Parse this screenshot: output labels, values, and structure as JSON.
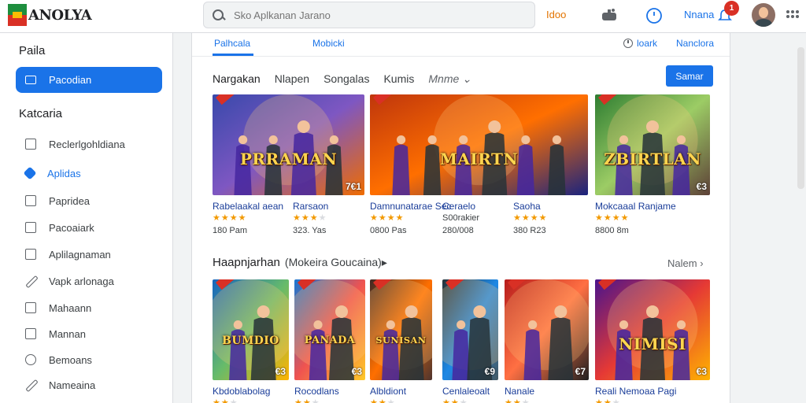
{
  "topbar": {
    "logo_text": "ANOLYA",
    "search_placeholder": "Sko Aplkanan Jarano",
    "link_label": "Idoo",
    "user_name": "Nnana",
    "notification_count": "1"
  },
  "sidebar": {
    "heading_top": "Paila",
    "active_item": "Pacodian",
    "heading_categories": "Katcaria",
    "items": [
      {
        "label": "Reclerlgohldiana",
        "icon": "monitor-icon"
      },
      {
        "label": "Aplidas",
        "icon": "diamond-icon"
      },
      {
        "label": "Papridea",
        "icon": "square-icon"
      },
      {
        "label": "Pacoaiark",
        "icon": "lock-icon"
      },
      {
        "label": "Aplilagnaman",
        "icon": "bag-icon"
      },
      {
        "label": "Vapk arlonaga",
        "icon": "pen-icon"
      },
      {
        "label": "Mahaann",
        "icon": "list-icon"
      },
      {
        "label": "Mannan",
        "icon": "grid-icon"
      },
      {
        "label": "Bemoans",
        "icon": "circle-icon"
      },
      {
        "label": "Nameaina",
        "icon": "tag-icon"
      }
    ]
  },
  "tabs": {
    "left": [
      "Palhcala",
      "Mobicki"
    ],
    "right_1": "loark",
    "right_2": "Nanclora"
  },
  "filters": [
    "Nargakan",
    "Nlapen",
    "Songalas",
    "Kumis",
    "Mnme ⌄"
  ],
  "see_all_button": "Samar",
  "section1_cards": [
    {
      "art_title": "PRRAMAN",
      "price": "7€1",
      "name": "Rabelaakal aean",
      "stars": 4,
      "count": "180 Pam",
      "palette": [
        "#3949ab",
        "#7e57c2",
        "#ef6c00"
      ]
    },
    {
      "art_title": "",
      "price": "",
      "name": "Rarsaon",
      "stars": 3,
      "count": "323. Yas",
      "palette": [
        "#3949ab",
        "#7e57c2",
        "#ef6c00"
      ]
    },
    {
      "art_title": "MAIRTN",
      "price": "",
      "name": "Damnunatarae Sec",
      "stars": 4,
      "count": "0800 Pas",
      "palette": [
        "#bf360c",
        "#ff6f00",
        "#1a237e"
      ]
    },
    {
      "art_title": "",
      "price": "€3",
      "name": "Ceraelo",
      "stars": 0,
      "count": "280/008",
      "palette": [
        "#0d47a1",
        "#1e88e5",
        "#263238"
      ],
      "sub": "S00rakier"
    },
    {
      "art_title": "",
      "price": "",
      "name": "Saoha",
      "stars": 4,
      "count": "380 R23",
      "palette": [
        "#0d47a1",
        "#1e88e5",
        "#263238"
      ]
    },
    {
      "art_title": "ZBIRTLAN",
      "price": "€3",
      "name": "Mokcaaal Ranjame",
      "stars": 5,
      "count": "8800 8m",
      "palette": [
        "#2e7d32",
        "#9ccc65",
        "#5d4037"
      ]
    }
  ],
  "section2": {
    "title": "Haapnjarhan",
    "subtitle": "(Mokeira Goucaina)▸",
    "more": "Nalem"
  },
  "section2_cards": [
    {
      "art_title": "BUMDIO",
      "price": "€3",
      "name": "Kbdoblabolag",
      "palette": [
        "#1565c0",
        "#66bb6a",
        "#ffb300"
      ]
    },
    {
      "art_title": "PANADA",
      "price": "€3",
      "name": "Rocodlans",
      "palette": [
        "#1976d2",
        "#ef5350",
        "#ffca28"
      ]
    },
    {
      "art_title": "SUNISAN",
      "price": "",
      "name": "Albldiont",
      "palette": [
        "#3e2723",
        "#ff6f00",
        "#4e342e"
      ]
    },
    {
      "art_title": "",
      "price": "€9",
      "name": "Cenlaleoalt",
      "palette": [
        "#263238",
        "#1e88e5",
        "#455a64"
      ]
    },
    {
      "art_title": "",
      "price": "€7",
      "name": "Nanale",
      "palette": [
        "#b71c1c",
        "#ff7043",
        "#212121"
      ]
    },
    {
      "art_title": "NIMISI",
      "price": "€3",
      "name": "Reali Nemoaa Pagi",
      "palette": [
        "#4a148c",
        "#e53935",
        "#ffb300"
      ]
    }
  ],
  "colors": {
    "accent": "#1a73e8",
    "star": "#f29900",
    "badge": "#d93025"
  }
}
